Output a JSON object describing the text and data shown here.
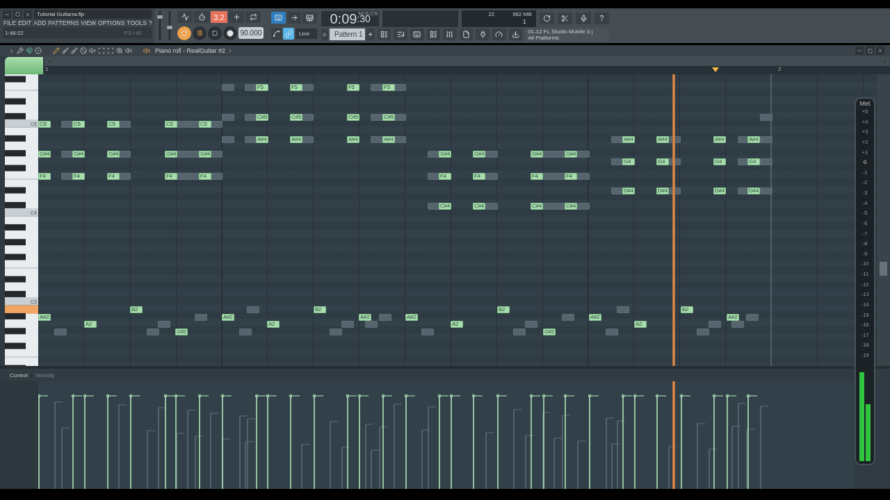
{
  "window": {
    "title": "Tutorial Guitarra.flp"
  },
  "menu": [
    "FILE",
    "EDIT",
    "ADD",
    "PATTERNS",
    "VIEW",
    "OPTIONS",
    "TOOLS",
    "?"
  ],
  "hint_bar": {
    "time": "1:48:22",
    "note": "F3 / 41"
  },
  "toolbar": {
    "step_display": "3.2",
    "tempo": "90.000",
    "snap": "Line",
    "song_time": "0:09:30",
    "time_format": "M:S:CS",
    "pattern": "Pattern 1",
    "pattern_add": "+",
    "cpu": "22",
    "memory": "962 MB",
    "polyphony": "1",
    "help": "?",
    "news": {
      "line_1": "01-12  FL Studio Mobile 3 |",
      "line_2": "All Platforms"
    }
  },
  "piano_roll": {
    "title": "Piano roll - RealGuitar #2",
    "ruler": [
      "1",
      "2"
    ],
    "octave_labels": [
      "C5",
      "C4",
      "C3"
    ],
    "notes": [
      {
        "label": "F5"
      },
      {
        "label": "F5"
      },
      {
        "label": "F5"
      },
      {
        "label": "F5"
      },
      {
        "label": "C#5"
      },
      {
        "label": "C#5"
      },
      {
        "label": "C#5"
      },
      {
        "label": "C#5"
      },
      {
        "label": "A#4"
      },
      {
        "label": "A#4"
      },
      {
        "label": "A#4"
      },
      {
        "label": "A#4"
      },
      {
        "label": "C5"
      },
      {
        "label": "C5"
      },
      {
        "label": "C5"
      },
      {
        "label": "C5"
      },
      {
        "label": "C5"
      },
      {
        "label": "G#4"
      },
      {
        "label": "G#4"
      },
      {
        "label": "G#4"
      },
      {
        "label": "G#4"
      },
      {
        "label": "G#4"
      },
      {
        "label": "F4"
      },
      {
        "label": "F4"
      },
      {
        "label": "F4"
      },
      {
        "label": "F4"
      },
      {
        "label": "F4"
      },
      {
        "label": "G#4"
      },
      {
        "label": "G#4"
      },
      {
        "label": "G#4"
      },
      {
        "label": "G#4"
      },
      {
        "label": "F4"
      },
      {
        "label": "F4"
      },
      {
        "label": "F4"
      },
      {
        "label": "F4"
      },
      {
        "label": "C#4"
      },
      {
        "label": "C#4"
      },
      {
        "label": "C#4"
      },
      {
        "label": "C#4"
      },
      {
        "label": "A#4"
      },
      {
        "label": "A#4"
      },
      {
        "label": "A#4"
      },
      {
        "label": "A#4"
      },
      {
        "label": "G4"
      },
      {
        "label": "G4"
      },
      {
        "label": "G4"
      },
      {
        "label": "G4"
      },
      {
        "label": "D#4"
      },
      {
        "label": "D#4"
      },
      {
        "label": "D#4"
      },
      {
        "label": "D#4"
      },
      {
        "label": "B2"
      },
      {
        "label": "B2"
      },
      {
        "label": "B2"
      },
      {
        "label": "B2"
      },
      {
        "label": "A#2"
      },
      {
        "label": "A#2"
      },
      {
        "label": "A#2"
      },
      {
        "label": "A#2"
      },
      {
        "label": "A#2"
      },
      {
        "label": "A#2"
      },
      {
        "label": "A2"
      },
      {
        "label": "A2"
      },
      {
        "label": "A2"
      },
      {
        "label": "A2"
      },
      {
        "label": "G#2"
      },
      {
        "label": "G#2"
      }
    ],
    "control": {
      "label": "Control",
      "target": "Velocity"
    }
  },
  "meter": {
    "title": "Met",
    "scale": [
      "+5",
      "+4",
      "+3",
      "+2",
      "+1",
      "0",
      "-1",
      "-2",
      "-3",
      "-4",
      "-5",
      "-6",
      "-7",
      "-8",
      "-9",
      "-10",
      "-11",
      "-12",
      "-13",
      "-14",
      "-15",
      "-16",
      "-17",
      "-18",
      "-19"
    ]
  }
}
